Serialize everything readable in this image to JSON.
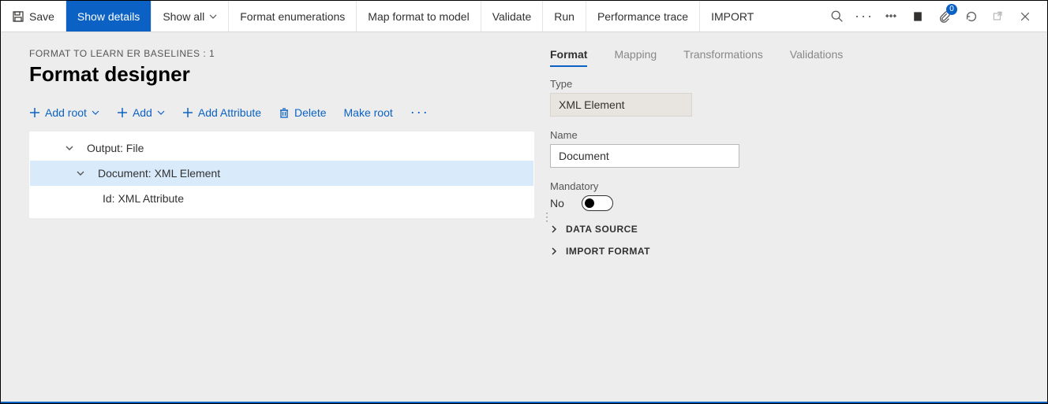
{
  "toolbar": {
    "save_label": "Save",
    "show_details_label": "Show details",
    "show_all_label": "Show all",
    "format_enumerations_label": "Format enumerations",
    "map_label": "Map format to model",
    "validate_label": "Validate",
    "run_label": "Run",
    "perf_trace_label": "Performance trace",
    "import_label": "IMPORT",
    "badge_count": "0"
  },
  "breadcrumb": "FORMAT TO LEARN ER BASELINES : 1",
  "page_title": "Format designer",
  "actions": {
    "add_root": "Add root",
    "add": "Add",
    "add_attribute": "Add Attribute",
    "delete": "Delete",
    "make_root": "Make root"
  },
  "tree": {
    "row0": "Output: File",
    "row1": "Document: XML Element",
    "row2": "Id: XML Attribute"
  },
  "tabs": {
    "format": "Format",
    "mapping": "Mapping",
    "transformations": "Transformations",
    "validations": "Validations"
  },
  "panel": {
    "type_label": "Type",
    "type_value": "XML Element",
    "name_label": "Name",
    "name_value": "Document",
    "mandatory_label": "Mandatory",
    "mandatory_value": "No",
    "data_source": "DATA SOURCE",
    "import_format": "IMPORT FORMAT"
  }
}
